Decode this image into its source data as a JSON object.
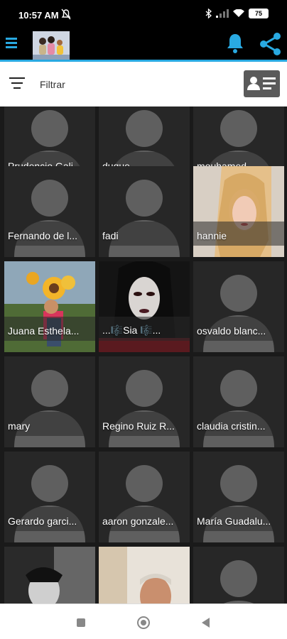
{
  "status_bar": {
    "time": "10:57 AM",
    "battery": "75"
  },
  "app_bar": {
    "menu_icon": "hamburger-icon",
    "notifications_icon": "bell-icon",
    "share_icon": "share-icon",
    "accent_color": "#29a9e1"
  },
  "filter_bar": {
    "label": "Filtrar",
    "filter_icon": "filter-icon",
    "contact_button_icon": "contact-card-icon"
  },
  "contacts": [
    {
      "name": "Prudencio Gali..."
    },
    {
      "name": "duque"
    },
    {
      "name": "mouhamed"
    },
    {
      "name": "Fernando de l..."
    },
    {
      "name": "fadi"
    },
    {
      "name": "hannie"
    },
    {
      "name": "Juana Esthela..."
    },
    {
      "name": "...🎼Sia 🎼..."
    },
    {
      "name": "osvaldo blanc..."
    },
    {
      "name": "mary"
    },
    {
      "name": "Regino Ruiz R..."
    },
    {
      "name": "claudia cristin..."
    },
    {
      "name": "Gerardo garci..."
    },
    {
      "name": "aaron gonzale..."
    },
    {
      "name": "María Guadalu..."
    },
    {
      "name": ""
    },
    {
      "name": ""
    },
    {
      "name": ""
    }
  ],
  "nav_bar": {
    "recents_icon": "square-icon",
    "home_icon": "circle-icon",
    "back_icon": "triangle-back-icon"
  }
}
